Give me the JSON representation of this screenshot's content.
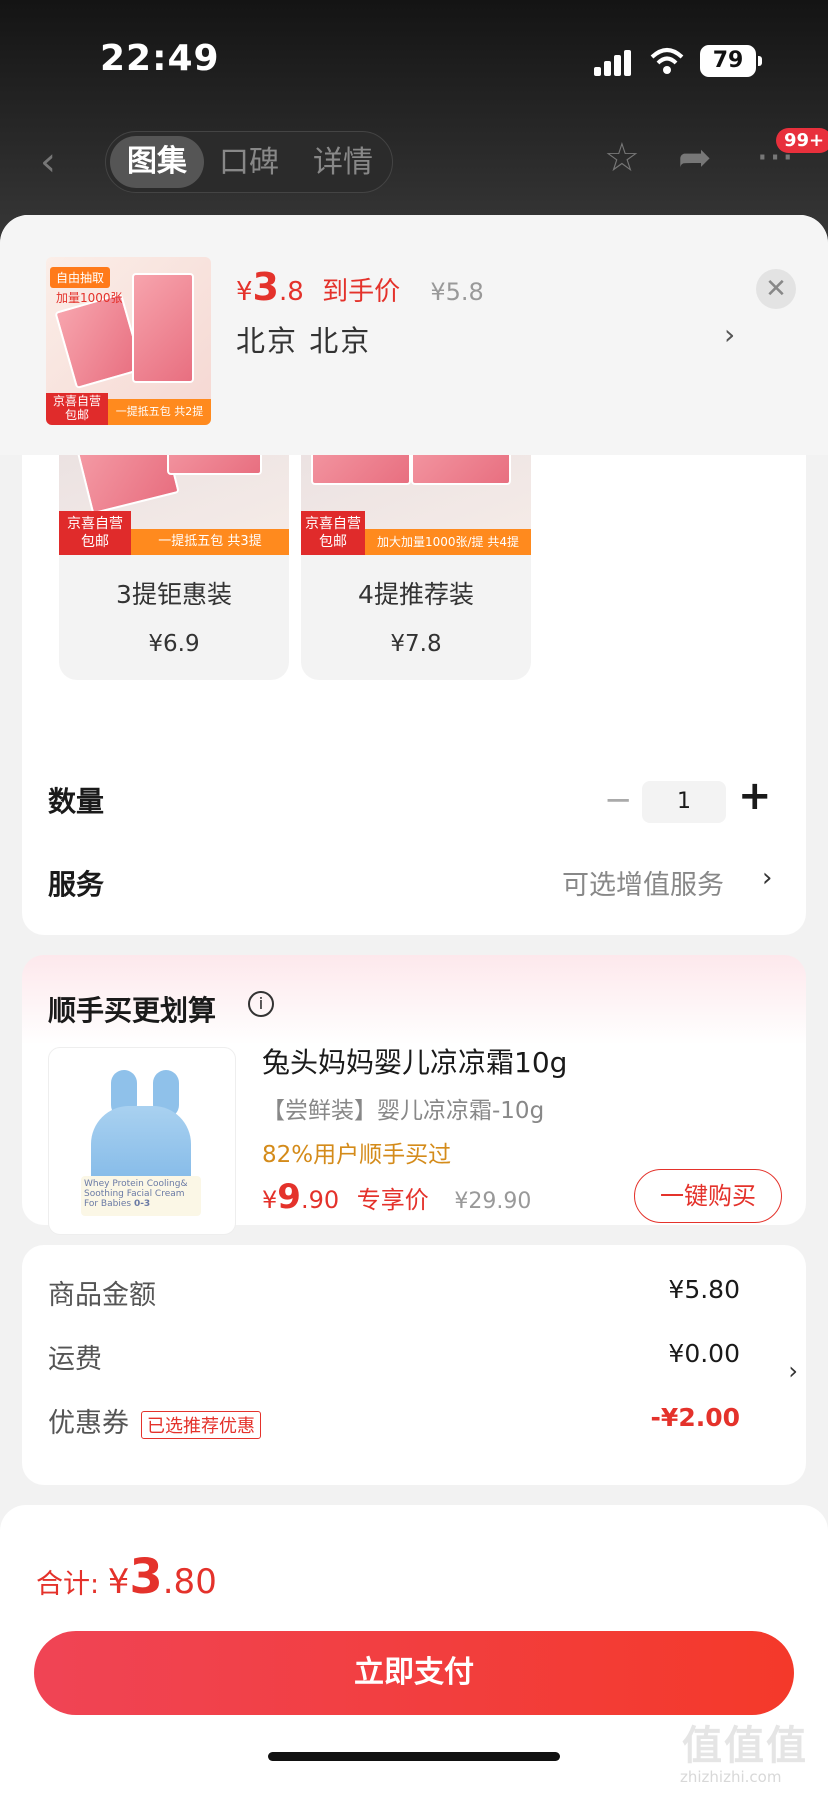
{
  "status": {
    "time": "22:49",
    "battery": "79"
  },
  "topnav": {
    "tabs": [
      "图集",
      "口碑",
      "详情"
    ],
    "badge": "99+"
  },
  "header": {
    "currency": "¥",
    "price_int": "3",
    "price_dec": ".8",
    "price_label": "到手价",
    "orig_price": "¥5.8",
    "address": "北京  北京",
    "thumb": {
      "tag_top": "自由抽取",
      "tag_top2": "加量1000张",
      "red_tag": "京喜自营 包邮",
      "orange_bar": "一提抵五包 共2提"
    }
  },
  "skus": [
    {
      "name": "3提钜惠装",
      "price": "¥6.9",
      "red_tag": "京喜自营 包邮",
      "orange_bar": "一提抵五包 共3提"
    },
    {
      "name": "4提推荐装",
      "price": "¥7.8",
      "red_tag": "京喜自营 包邮",
      "orange_bar": "加大加量1000张/提 共4提"
    }
  ],
  "quantity": {
    "label": "数量",
    "value": "1"
  },
  "service": {
    "label": "服务",
    "value": "可选增值服务"
  },
  "upsell": {
    "title": "顺手买更划算",
    "product": {
      "name": "兔头妈妈婴儿凉凉霜10g",
      "sub": "【尝鲜装】婴儿凉凉霜-10g",
      "users": "82%用户顺手买过",
      "currency": "¥",
      "price_int": "9",
      "price_dec": ".90",
      "price_label": "专享价",
      "orig": "¥29.90",
      "buy": "一键购买",
      "jar_text": "Whey Protein Cooling& Soothing Facial Cream For Babies",
      "jar_age": "0-3"
    }
  },
  "fees": {
    "goods_label": "商品金额",
    "goods_val": "¥5.80",
    "ship_label": "运费",
    "ship_val": "¥0.00",
    "coupon_label": "优惠券",
    "coupon_tag": "已选推荐优惠",
    "coupon_val": "-¥2.00"
  },
  "footer": {
    "total_label": "合计:",
    "currency": "¥",
    "int": "3",
    "dec": ".80",
    "pay": "立即支付"
  },
  "watermark": {
    "main": "值值值",
    "sub": "zhizhizhi.com"
  },
  "colors": {
    "accent": "#e4322b",
    "orange": "#ff8a1e"
  }
}
